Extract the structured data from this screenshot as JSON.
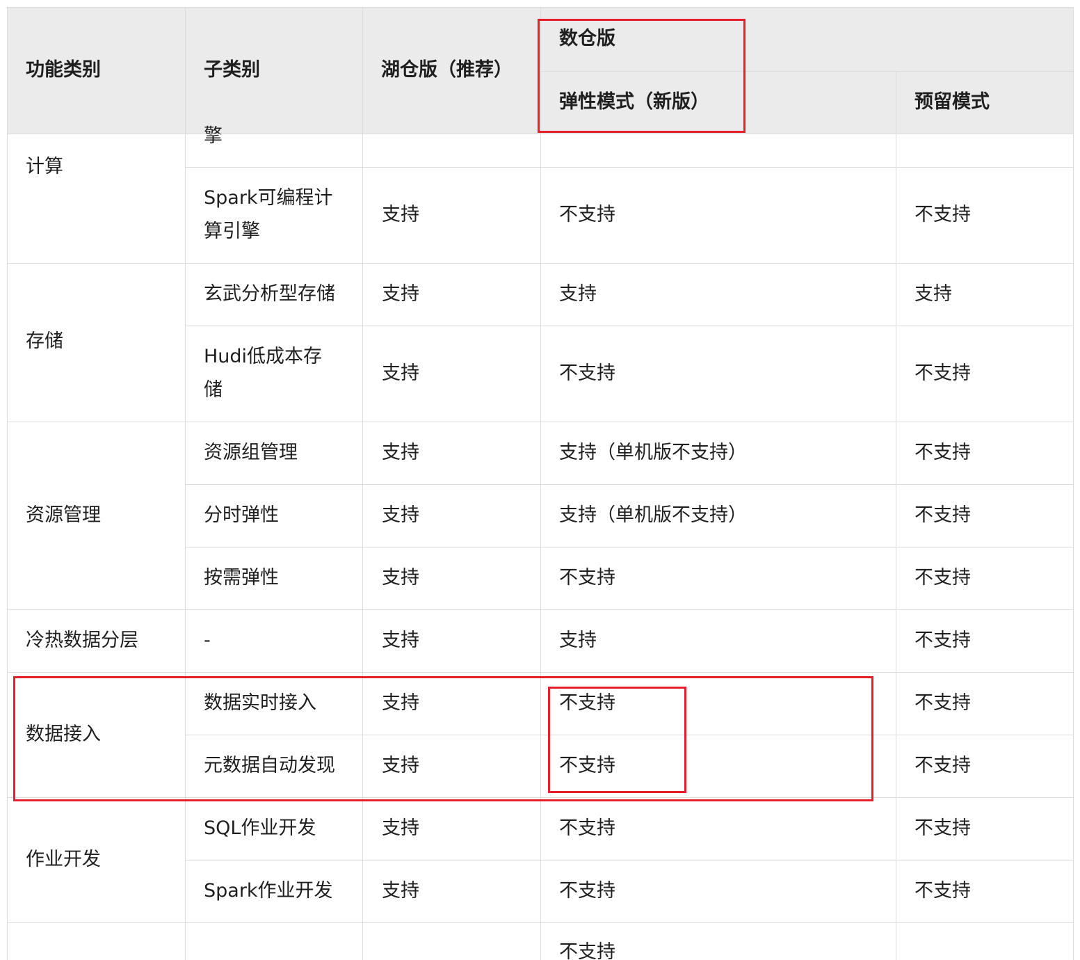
{
  "header": {
    "category": "功能类别",
    "subcategory": "子类别",
    "lake_edition": "湖仓版（推荐）",
    "warehouse_edition": "数仓版",
    "elastic_mode": "弹性模式（新版）",
    "reserved_mode": "预留模式"
  },
  "rows": {
    "compute": {
      "category": "计算",
      "engine_partial": "擎",
      "spark_engine": {
        "line1": "Spark可编程计",
        "line2": "算引擎",
        "lake": "支持",
        "elastic": "不支持",
        "reserved": "不支持"
      }
    },
    "storage": {
      "category": "存储",
      "xuanwu": {
        "name": "玄武分析型存储",
        "lake": "支持",
        "elastic": "支持",
        "reserved": "支持"
      },
      "hudi": {
        "line1": "Hudi低成本存",
        "line2": "储",
        "lake": "支持",
        "elastic": "不支持",
        "reserved": "不支持"
      }
    },
    "resource": {
      "category": "资源管理",
      "group": {
        "name": "资源组管理",
        "lake": "支持",
        "elastic": "支持（单机版不支持）",
        "reserved": "不支持"
      },
      "timeshare": {
        "name": "分时弹性",
        "lake": "支持",
        "elastic": "支持（单机版不支持）",
        "reserved": "不支持"
      },
      "ondemand": {
        "name": "按需弹性",
        "lake": "支持",
        "elastic": "不支持",
        "reserved": "不支持"
      }
    },
    "tiering": {
      "category": "冷热数据分层",
      "sub": "-",
      "lake": "支持",
      "elastic": "支持",
      "reserved": "不支持"
    },
    "ingest": {
      "category": "数据接入",
      "realtime": {
        "name": "数据实时接入",
        "lake": "支持",
        "elastic": "不支持",
        "reserved": "不支持"
      },
      "discovery": {
        "name": "元数据自动发现",
        "lake": "支持",
        "elastic": "不支持",
        "reserved": "不支持"
      }
    },
    "jobs": {
      "category": "作业开发",
      "sql": {
        "name": "SQL作业开发",
        "lake": "支持",
        "elastic": "不支持",
        "reserved": "不支持"
      },
      "spark": {
        "name": "Spark作业开发",
        "lake": "支持",
        "elastic": "不支持",
        "reserved": "不支持"
      }
    },
    "partial_bottom": {
      "elastic": "不支持"
    }
  },
  "colors": {
    "header_bg": "#ebebeb",
    "border": "#dcdcdc",
    "highlight": "#e5202b",
    "text": "#1f1f1f"
  }
}
